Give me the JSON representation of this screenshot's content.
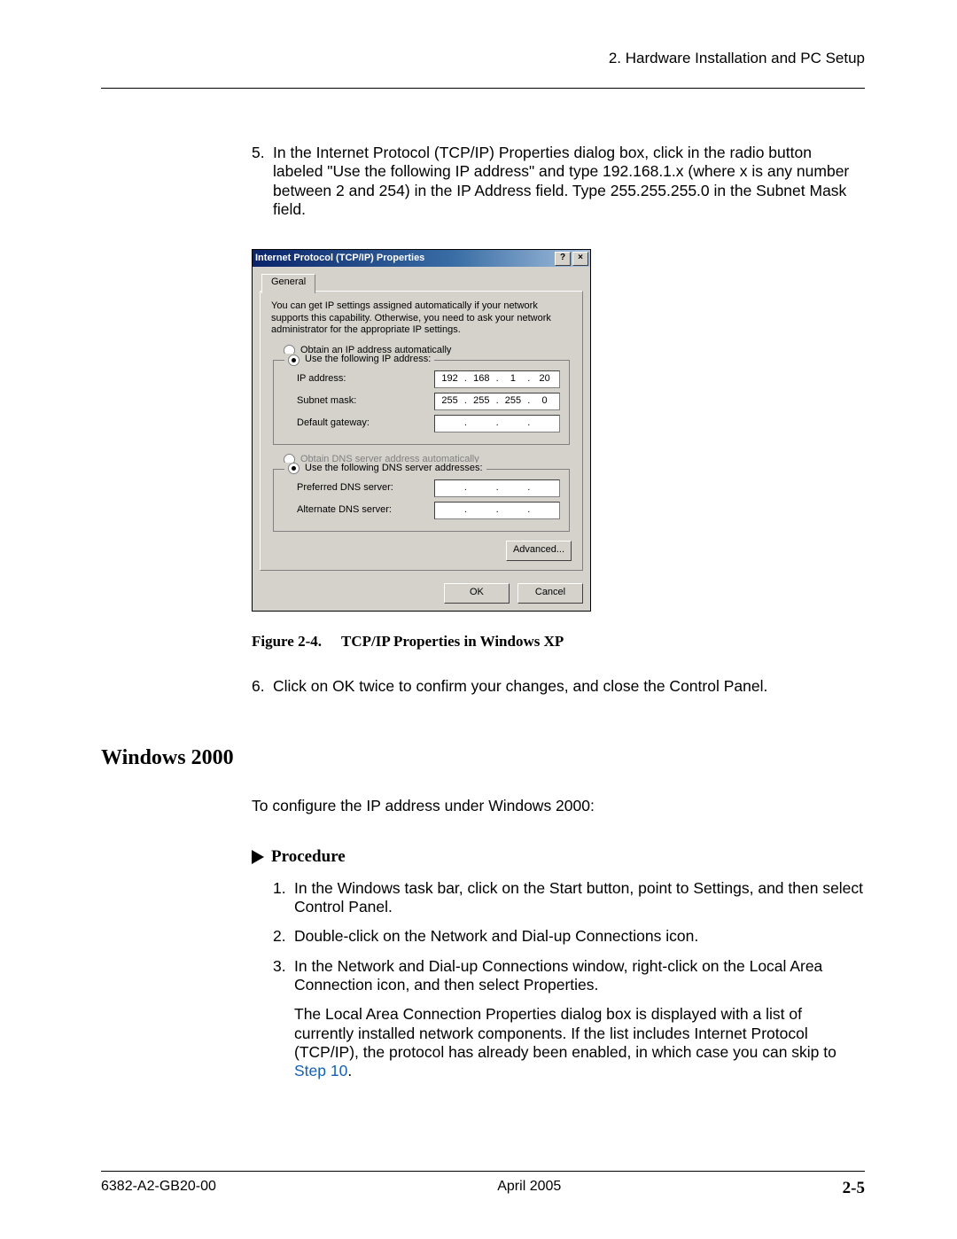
{
  "header": {
    "chapter": "2. Hardware Installation and PC Setup"
  },
  "step5": {
    "num": "5.",
    "text": "In the Internet Protocol (TCP/IP) Properties dialog box, click in the radio button labeled \"Use the following IP address\" and type 192.168.1.x (where x is any number between 2 and 254) in the IP Address field. Type 255.255.255.0 in the Subnet Mask field."
  },
  "dialog": {
    "title": "Internet Protocol (TCP/IP) Properties",
    "help_btn": "?",
    "close_btn": "×",
    "tab": "General",
    "info": "You can get IP settings assigned automatically if your network supports this capability. Otherwise, you need to ask your network administrator for the appropriate IP settings.",
    "r_auto_ip": "Obtain an IP address automatically",
    "r_use_ip": "Use the following IP address:",
    "lbl_ip": "IP address:",
    "lbl_mask": "Subnet mask:",
    "lbl_gw": "Default gateway:",
    "ip": {
      "a": "192",
      "b": "168",
      "c": "1",
      "d": "20"
    },
    "mask": {
      "a": "255",
      "b": "255",
      "c": "255",
      "d": "0"
    },
    "gw": {
      "a": "",
      "b": "",
      "c": "",
      "d": ""
    },
    "r_auto_dns": "Obtain DNS server address automatically",
    "r_use_dns": "Use the following DNS server addresses:",
    "lbl_pdns": "Preferred DNS server:",
    "lbl_adns": "Alternate DNS server:",
    "btn_adv": "Advanced...",
    "btn_ok": "OK",
    "btn_cancel": "Cancel"
  },
  "figcap": {
    "label": "Figure 2-4.",
    "title": "TCP/IP Properties in Windows XP"
  },
  "step6": {
    "num": "6.",
    "text": "Click on OK twice to confirm your changes, and close the Control Panel."
  },
  "section": "Windows 2000",
  "intro": "To configure the IP address under Windows 2000:",
  "proc_label": "Procedure",
  "proc": {
    "s1": {
      "num": "1.",
      "text": "In the Windows task bar, click on the Start button, point to Settings, and then select Control Panel."
    },
    "s2": {
      "num": "2.",
      "text": "Double-click on the Network and Dial-up Connections icon."
    },
    "s3": {
      "num": "3.",
      "text": "In the Network and Dial-up Connections window, right-click on the Local Area Connection icon, and then select Properties."
    },
    "note_a": "The Local Area Connection Properties dialog box is displayed with a list of currently installed network components. If the list includes Internet Protocol (TCP/IP), the protocol has already been enabled, in which case you can skip to ",
    "note_link": "Step 10",
    "note_b": "."
  },
  "footer": {
    "doc": "6382-A2-GB20-00",
    "date": "April 2005",
    "page": "2-5"
  }
}
